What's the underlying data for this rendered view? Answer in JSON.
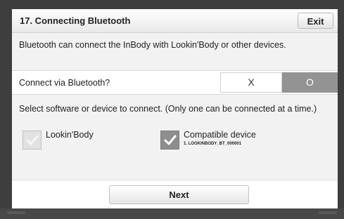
{
  "header": {
    "title": "17. Connecting Bluetooth",
    "exit_label": "Exit"
  },
  "description": "Bluetooth can connect the InBody with Lookin'Body or other devices.",
  "bluetooth": {
    "question": "Connect via Bluetooth?",
    "option_no": "X",
    "option_yes": "O",
    "selected": "O"
  },
  "select_prompt": "Select software or device to connect. (Only one can be connected at a time.)",
  "options": [
    {
      "label": "Lookin'Body",
      "checked": false,
      "icon": "check-icon"
    },
    {
      "label": "Compatible device",
      "sub": "1. LOOKINBODY_BT_000001",
      "checked": true,
      "icon": "check-icon"
    }
  ],
  "footer": {
    "next_label": "Next"
  },
  "colors": {
    "selected_toggle": "#939393",
    "checked_box": "#8e8e8e",
    "unchecked_box": "#e2e2e2"
  }
}
